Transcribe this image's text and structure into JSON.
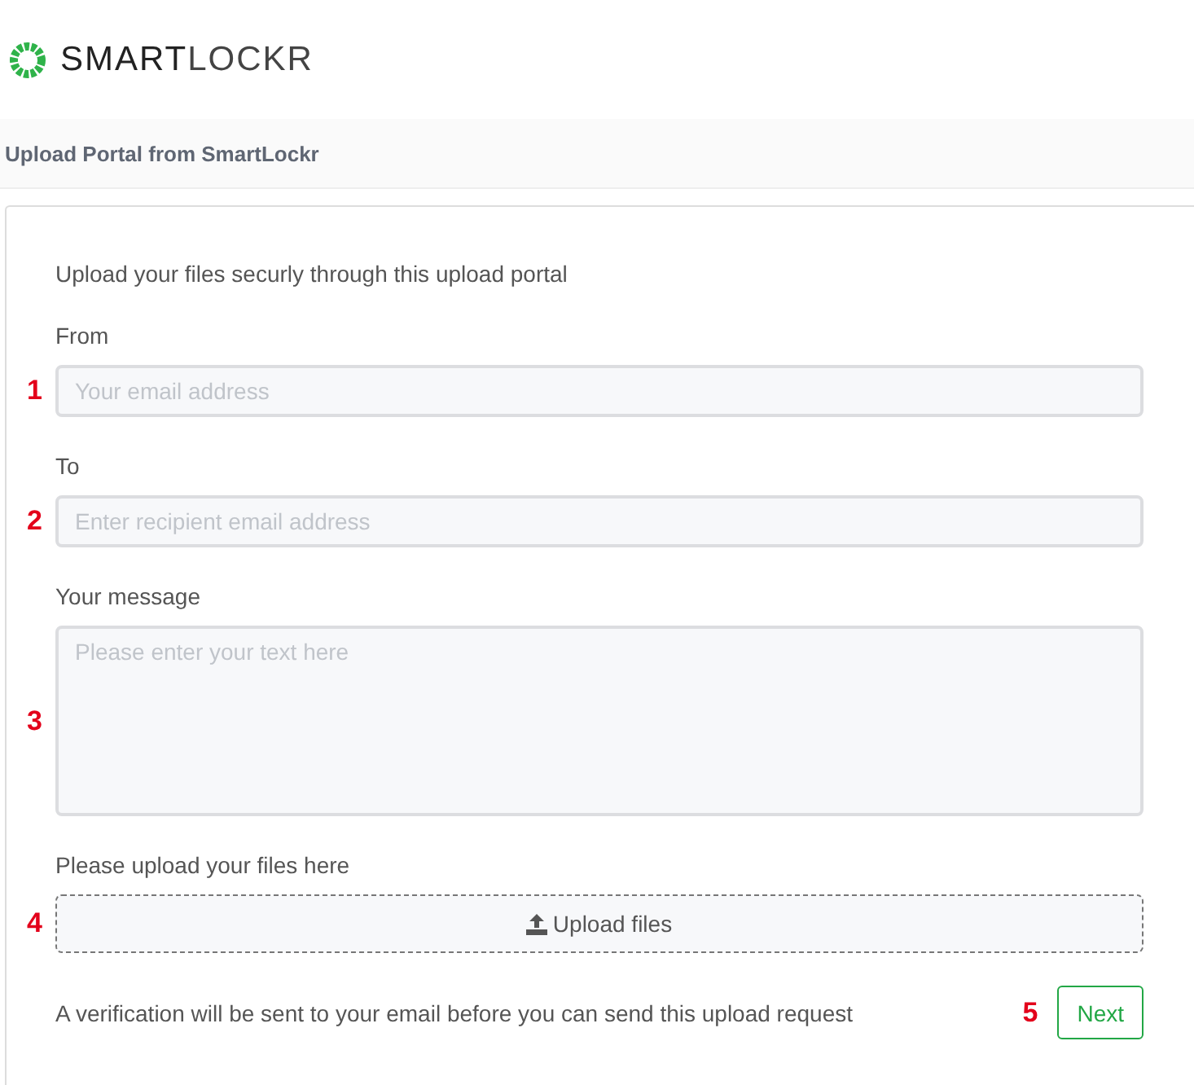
{
  "logo": {
    "bold": "SMART",
    "light": "LOCKR"
  },
  "header": {
    "title": "Upload Portal from SmartLockr"
  },
  "intro": "Upload your files securly through this upload portal",
  "fields": [
    {
      "kind": "input",
      "label": "From",
      "placeholder": "Your email address",
      "marker": "1"
    },
    {
      "kind": "input",
      "label": "To",
      "placeholder": "Enter recipient email address",
      "marker": "2"
    },
    {
      "kind": "textarea",
      "label": "Your message",
      "placeholder": "Please enter your text here",
      "marker": "3"
    }
  ],
  "upload": {
    "label": "Please upload your files here",
    "button": "Upload files",
    "marker": "4"
  },
  "footer": {
    "note": "A verification will be sent to your email before you can send this upload request",
    "button": "Next",
    "marker": "5"
  }
}
